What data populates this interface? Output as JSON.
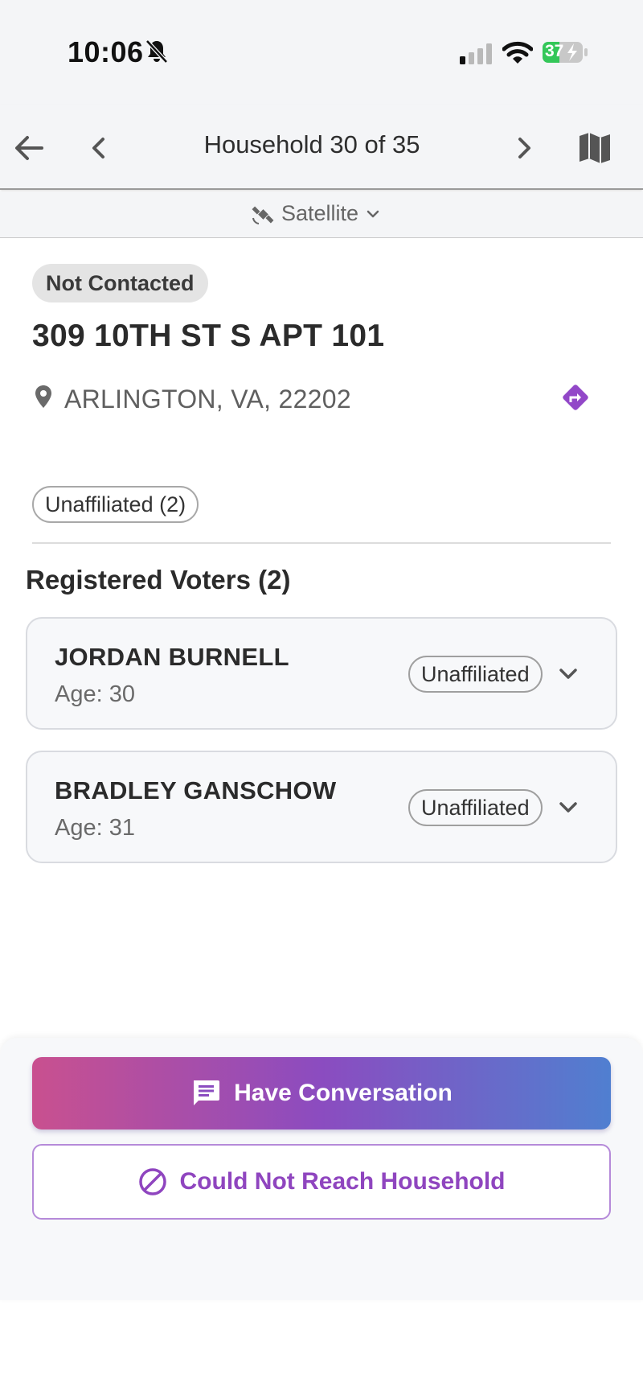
{
  "status_bar": {
    "time": "10:06",
    "battery_level": "37"
  },
  "header": {
    "title": "Household 30 of 35"
  },
  "map_layer": {
    "label": "Satellite"
  },
  "household": {
    "status": "Not Contacted",
    "address": "309 10TH ST S APT 101",
    "city_line": "ARLINGTON, VA, 22202",
    "party_summary": "Unaffiliated (2)"
  },
  "voters_section": {
    "title": "Registered Voters (2)",
    "voters": [
      {
        "name": "JORDAN BURNELL",
        "age": "Age: 30",
        "party": "Unaffiliated"
      },
      {
        "name": "BRADLEY GANSCHOW",
        "age": "Age: 31",
        "party": "Unaffiliated"
      }
    ]
  },
  "actions": {
    "primary_label": "Have Conversation",
    "secondary_label": "Could Not Reach Household"
  },
  "colors": {
    "accent_purple": "#8f45bf",
    "gradient_start": "#c9508f",
    "gradient_mid": "#8b4cc0",
    "gradient_end": "#507fd0",
    "battery_green": "#34c759"
  },
  "icons": {
    "back": "arrow-left-icon",
    "prev": "chevron-left-icon",
    "next": "chevron-right-icon",
    "map": "map-icon",
    "satellite": "satellite-icon",
    "layer_dropdown": "chevron-down-icon",
    "location": "location-pin-icon",
    "directions": "directions-icon",
    "expand": "chevron-down-icon",
    "conversation": "chat-icon",
    "not_reached": "block-icon",
    "muted": "bell-slash-icon"
  }
}
